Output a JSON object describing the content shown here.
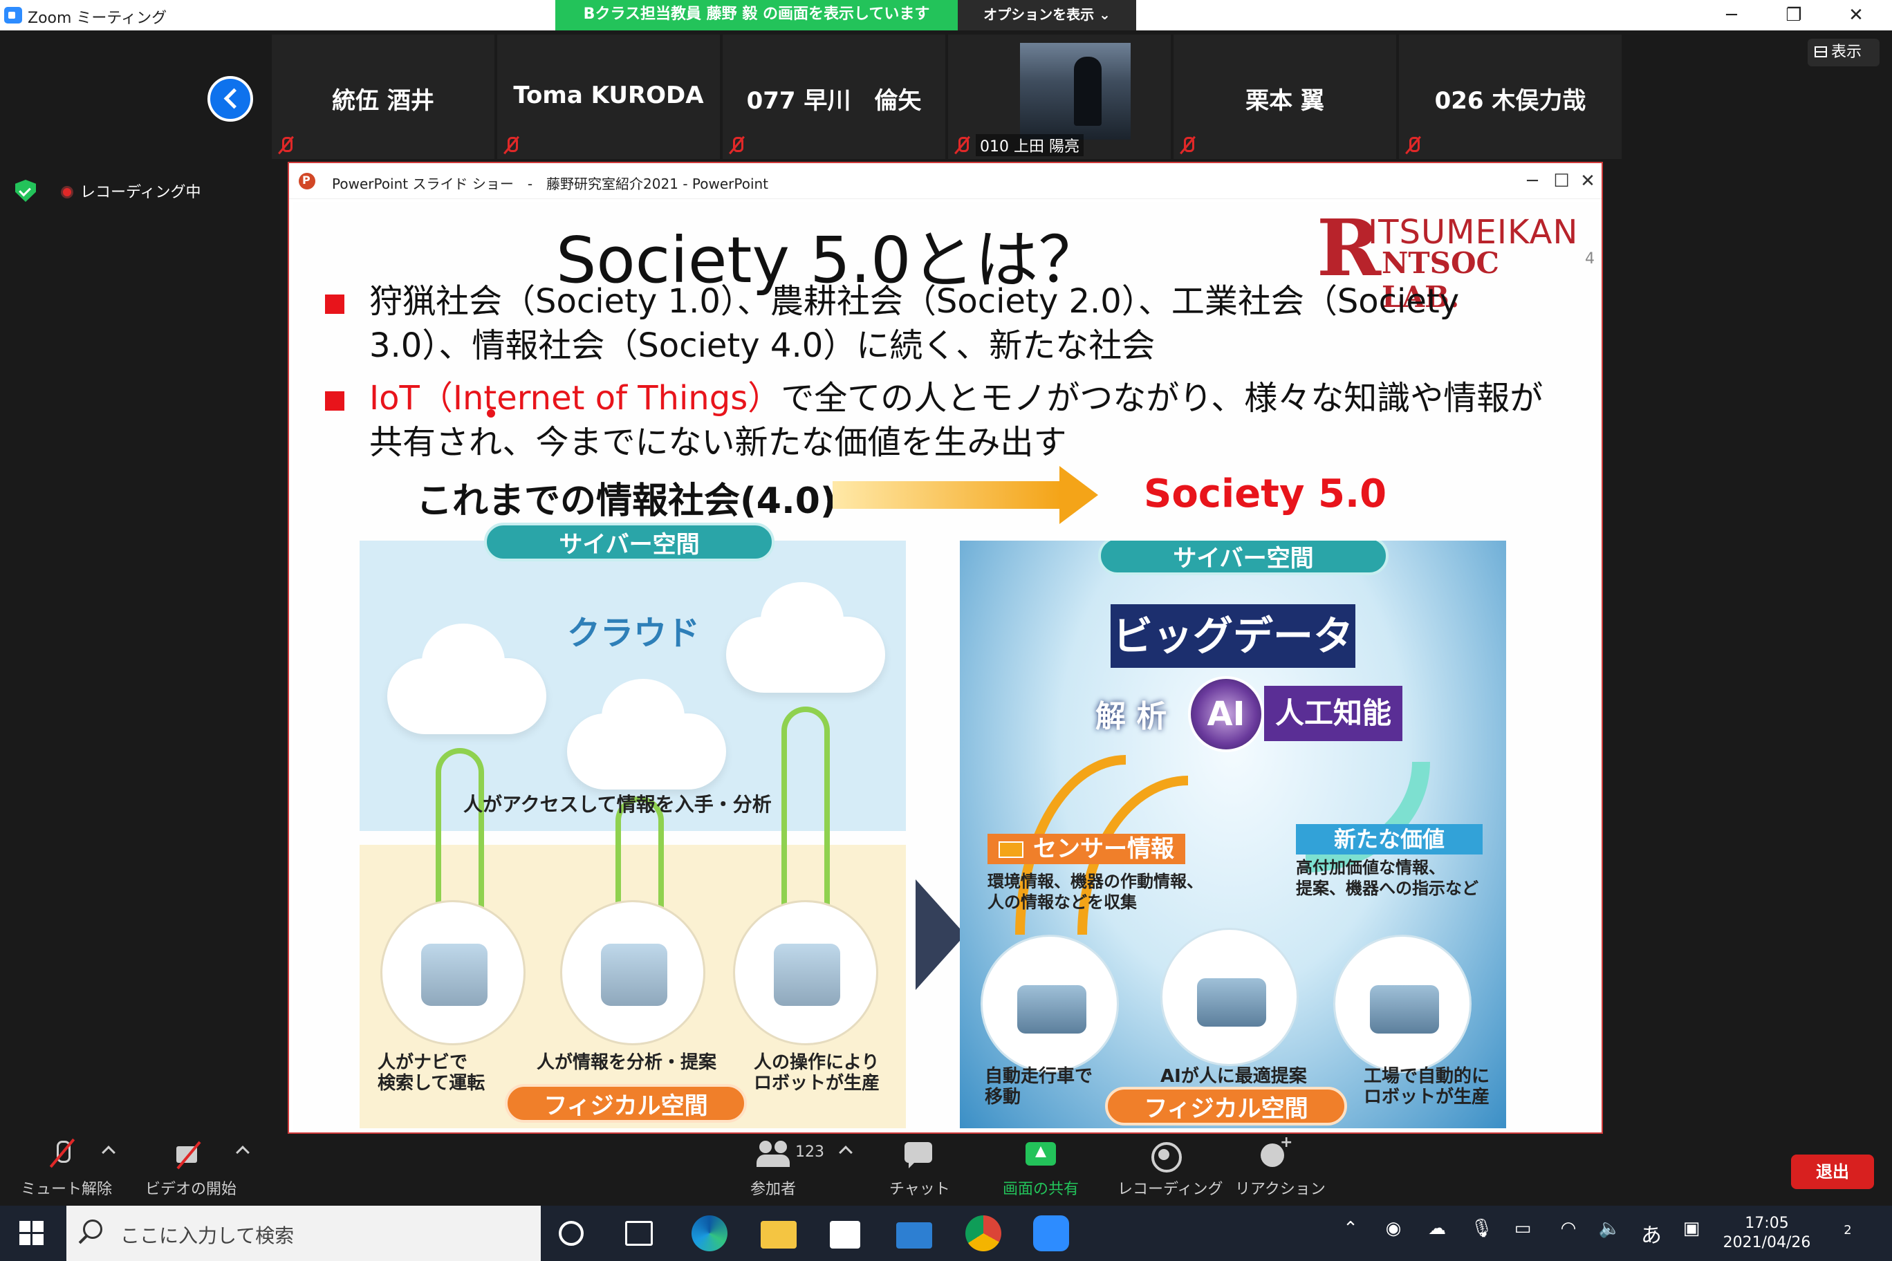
{
  "window": {
    "title": "Zoom ミーティング",
    "minimize": "─",
    "restore": "❐",
    "close": "✕"
  },
  "share_banner": "Bクラス担当教員 藤野 毅 の画面を表示しています",
  "options_button": "オプションを表示 ⌄",
  "view_button": "表示",
  "participants": [
    {
      "name": "統伍 酒井"
    },
    {
      "name": "Toma KURODA"
    },
    {
      "name": "077 早川　倫矢"
    },
    {
      "name": "010 上田 陽亮"
    },
    {
      "name": "栗本 翼"
    },
    {
      "name": "026 木俣力哉"
    }
  ],
  "recording_status": "レコーディング中",
  "ppt": {
    "title": "PowerPoint スライド ショー　-　藤野研究室紹介2021 - PowerPoint",
    "minimize": "─",
    "maximize": "☐",
    "close": "✕"
  },
  "slide": {
    "title": "Society 5.0とは？",
    "brand_r": "R",
    "brand_top": "ITSUMEIKAN",
    "brand_bottom": "NTSOC LAB.",
    "page_number": "4",
    "bullet1": "狩猟社会（Society 1.0）、農耕社会（Society 2.0）、工業社会（Society 3.0）、情報社会（Society 4.0）に続く、新たな社会",
    "bullet2_red": "IoT（Internet of Things）",
    "bullet2_rest": "で全ての人とモノがつながり、様々な知識や情報が共有され、今までにない新たな価値を生み出す",
    "flow_from": "これまでの情報社会(4.0)",
    "flow_to": "Society 5.0",
    "left": {
      "cyber": "サイバー空間",
      "cloud": "クラウド",
      "access": "人がアクセスして情報を入手・分析",
      "physical": "フィジカル空間",
      "captions": [
        "人がナビで\n検索して運転",
        "人が情報を分析・提案",
        "人の操作により\nロボットが生産"
      ]
    },
    "right": {
      "cyber": "サイバー空間",
      "bigdata": "ビッグデータ",
      "analysis": "解 析",
      "ai": "AI",
      "ai_label": "人工知能",
      "sensor": "センサー情報",
      "sensor_desc": "環境情報、機器の作動情報、\n人の情報などを収集",
      "new_value": "新たな価値",
      "new_value_desc": "高付加価値な情報、\n提案、機器への指示など",
      "physical": "フィジカル空間",
      "captions": [
        "自動走行車で\n移動",
        "AIが人に最適提案",
        "工場で自動的に\nロボットが生産"
      ]
    }
  },
  "toolbar": {
    "unmute": "ミュート解除",
    "start_video": "ビデオの開始",
    "participants": "参加者",
    "participant_count": "123",
    "chat": "チャット",
    "share": "画面の共有",
    "record": "レコーディング",
    "reactions": "リアクション",
    "leave": "退出"
  },
  "taskbar": {
    "search_placeholder": "ここに入力して検索",
    "ime": "あ",
    "time": "17:05",
    "date": "2021/04/26",
    "notification_count": "2"
  },
  "colors": {
    "zoom_blue": "#2d8cff",
    "share_green": "#23c35a",
    "leave_red": "#d8201f",
    "slide_red": "#e8141b"
  }
}
